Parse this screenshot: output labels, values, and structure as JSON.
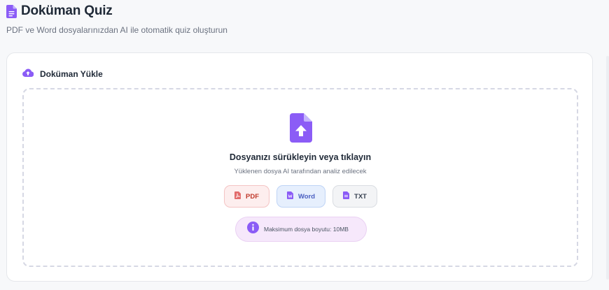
{
  "header": {
    "title": "Doküman Quiz",
    "subtitle": "PDF ve Word dosyalarınızdan AI ile otomatik quiz oluşturun"
  },
  "upload_card": {
    "title": "Doküman Yükle",
    "dropzone": {
      "title": "Dosyanızı sürükleyin veya tıklayın",
      "subtitle": "Yüklenen dosya AI tarafından analiz edilecek"
    },
    "file_types": [
      {
        "label": "PDF",
        "icon": "pdf-file-icon"
      },
      {
        "label": "Word",
        "icon": "word-file-icon"
      },
      {
        "label": "TXT",
        "icon": "text-file-icon"
      }
    ],
    "info": "Maksimum dosya boyutu: 10MB"
  },
  "colors": {
    "accent": "#8b5cf6",
    "pdf": "#c0392b",
    "word": "#4a5fc1",
    "txt": "#374151"
  }
}
